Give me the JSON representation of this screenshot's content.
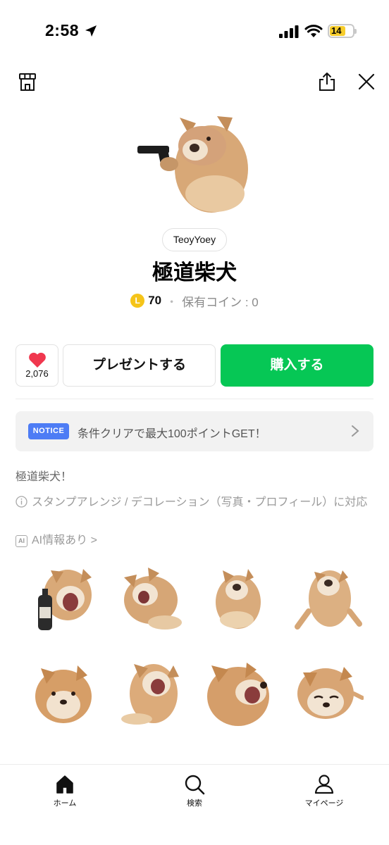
{
  "status_bar": {
    "time": "2:58",
    "battery_level": "14"
  },
  "product": {
    "author": "TeoyYoey",
    "title": "極道柴犬",
    "coin_badge": "L",
    "price": "70",
    "price_separator": "・",
    "owned_coins": "保有コイン : 0"
  },
  "actions": {
    "like_count": "2,076",
    "present_label": "プレゼントする",
    "buy_label": "購入する"
  },
  "notice": {
    "tag": "NOTICE",
    "text": "条件クリアで最大100ポイントGET！"
  },
  "description": "極道柴犬！",
  "feature_text": "スタンプアレンジ / デコレーション（写真・プロフィール）に対応",
  "ai_badge": "AI",
  "ai_info": "AI情報あり >",
  "nav": {
    "home": "ホーム",
    "search": "検索",
    "mypage": "マイページ"
  },
  "colors": {
    "buy_green": "#06c755",
    "notice_blue": "#4d7cf5",
    "heart_red": "#f0374e",
    "coin_yellow": "#f5c419"
  }
}
